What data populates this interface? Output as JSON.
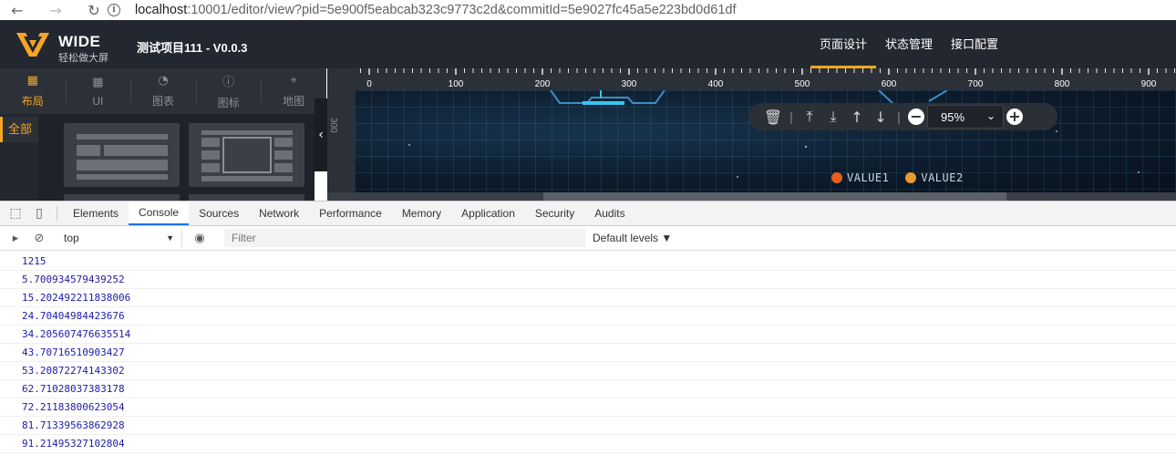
{
  "browser": {
    "url_host": "localhost",
    "url_rest": ":10001/editor/view?pid=5e900f5eabcab323c9773c2d&commitId=5e9027fc45a5e223bd0d61df"
  },
  "app": {
    "brand": "WIDE",
    "brand_sub": "轻松做大屏",
    "project_title": "测试项目111 - V0.0.3",
    "nav": [
      "页面设计",
      "状态管理",
      "接口配置"
    ],
    "active_nav": 0
  },
  "left_panel": {
    "tabs": [
      {
        "label": "布局",
        "icon": "layout-icon"
      },
      {
        "label": "UI",
        "icon": "ui-grid-icon"
      },
      {
        "label": "图表",
        "icon": "chart-icon"
      },
      {
        "label": "图标",
        "icon": "info-icon"
      },
      {
        "label": "地图",
        "icon": "map-pin-icon"
      }
    ],
    "active_tab": 0,
    "category": "全部"
  },
  "canvas": {
    "ruler_h": [
      "0",
      "100",
      "200",
      "300",
      "400",
      "500",
      "600",
      "700",
      "800",
      "900"
    ],
    "ruler_v": "300",
    "zoom": "95%",
    "legend": [
      {
        "label": "VALUE1",
        "color": "#e8601c"
      },
      {
        "label": "VALUE2",
        "color": "#e89b2c"
      }
    ]
  },
  "devtools": {
    "tabs": [
      "Elements",
      "Console",
      "Sources",
      "Network",
      "Performance",
      "Memory",
      "Application",
      "Security",
      "Audits"
    ],
    "active_tab": 1,
    "context": "top",
    "filter_placeholder": "Filter",
    "levels": "Default levels ▼",
    "logs": [
      "1215",
      "5.700934579439252",
      "15.202492211838006",
      "24.70404984423676",
      "34.205607476635514",
      "43.70716510903427",
      "53.20872274143302",
      "62.71028037383178",
      "72.21183800623054",
      "81.71339563862928",
      "91.21495327102804"
    ]
  }
}
